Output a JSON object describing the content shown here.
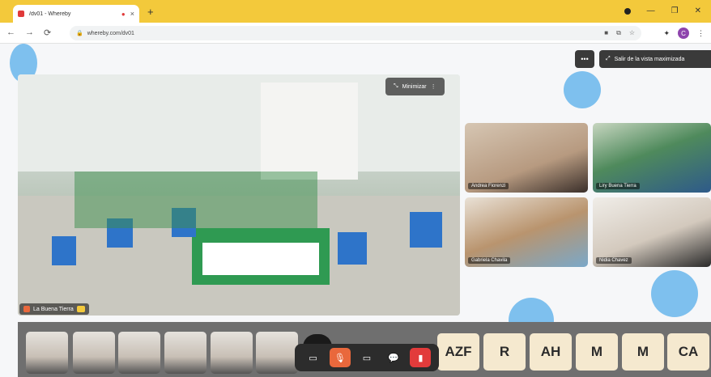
{
  "browser": {
    "tab_title": "/dv01 - Whereby",
    "tab_close": "×",
    "new_tab": "+",
    "url": "whereby.com/dv01",
    "window_controls": {
      "minimize": "—",
      "maximize": "❐",
      "close": "✕"
    },
    "nav": {
      "back": "←",
      "forward": "→",
      "reload": "⟳"
    },
    "profile_initial": "C"
  },
  "meeting": {
    "main_video": {
      "minimize_label": "Minimizar",
      "name": "La Buena Tierra"
    },
    "top_controls": {
      "more_label": "•••",
      "exit_label": "Salir de la vista maximizada"
    },
    "participants": [
      {
        "name": "Andrea Fiorenzi"
      },
      {
        "name": "Liry Buena Tierra"
      },
      {
        "name": "Gabriela Chavila"
      },
      {
        "name": "Nidia Chavez"
      }
    ],
    "strip_initials": [
      "AZF",
      "R",
      "AH",
      "M",
      "M",
      "CA"
    ],
    "controls": {
      "camera": "▭",
      "mic": "🎙",
      "screenshare": "▭",
      "chat": "💬",
      "leave": "▮"
    }
  },
  "colors": {
    "tabbar": "#f3c93b",
    "accent_blue": "#7ec0ee",
    "tile_initial_bg": "#f5e9cf",
    "mic_off": "#e9683c",
    "leave": "#e23b3b"
  }
}
